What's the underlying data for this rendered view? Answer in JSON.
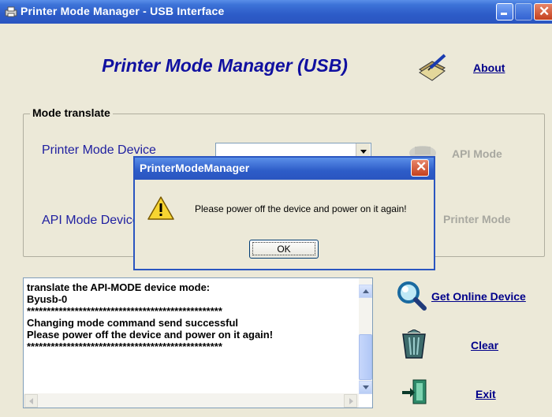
{
  "window": {
    "title": "Printer Mode Manager - USB Interface",
    "heading": "Printer Mode Manager (USB)",
    "about_label": "About"
  },
  "mode_group": {
    "title": "Mode translate",
    "printer_mode_device_label": "Printer Mode Device",
    "api_mode_device_label": "API Mode Device",
    "printer_mode_combo_value": "",
    "api_mode_button": "API Mode",
    "printer_mode_button": "Printer Mode"
  },
  "log": {
    "text": "translate the API-MODE device mode:\nByusb-0\n*************************************************\nChanging mode command send successful\nPlease power off the device and power on it again!\n*************************************************"
  },
  "side_buttons": {
    "online_label": "Get Online Device",
    "clear_label": "Clear",
    "exit_label": "Exit"
  },
  "dialog": {
    "title": "PrinterModeManager",
    "message": "Please power off the device and power on it again!",
    "ok_label": "OK",
    "icon": "warning-icon"
  },
  "colors": {
    "title_bar": "#2a55c0",
    "window_bg": "#ECE9D8",
    "heading": "#1010a0",
    "link": "#00008a",
    "disabled": "#a8a8a0",
    "close_button": "#c4401e"
  }
}
